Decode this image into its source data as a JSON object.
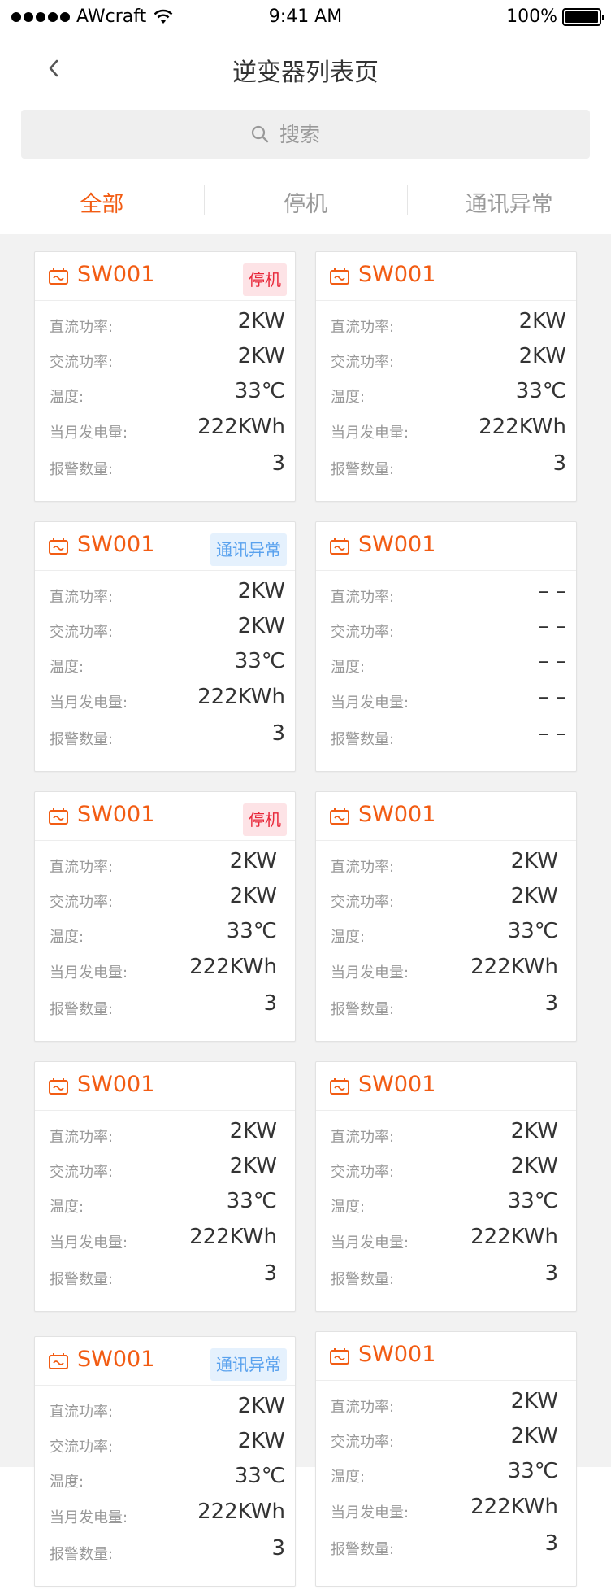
{
  "status_bar": {
    "carrier": "AWcraft",
    "time": "9:41 AM",
    "battery": "100%"
  },
  "nav": {
    "title": "逆变器列表页"
  },
  "search": {
    "placeholder": "搜索"
  },
  "tabs": [
    {
      "label": "全部",
      "active": true
    },
    {
      "label": "停机",
      "active": false
    },
    {
      "label": "通讯异常",
      "active": false
    }
  ],
  "colors": {
    "accent": "#f25c13",
    "stop_badge_bg": "#fde3e6",
    "stop_badge_text": "#e8283a",
    "comm_badge_bg": "#e5f1fd",
    "comm_badge_text": "#5aa2ee"
  },
  "field_labels": {
    "dc_power": "直流功率:",
    "ac_power": "交流功率:",
    "temperature": "温度:",
    "monthly_gen": "当月发电量:",
    "alarm_count": "报警数量:"
  },
  "cards": [
    {
      "name": "SW001",
      "badge": "停机",
      "badge_type": "stop",
      "dc": "2KW",
      "ac": "2KW",
      "temp": "33℃",
      "gen": "222KWh",
      "alarms": "3"
    },
    {
      "name": "SW001",
      "badge": "",
      "badge_type": "",
      "dc": "2KW",
      "ac": "2KW",
      "temp": "33℃",
      "gen": "222KWh",
      "alarms": "3"
    },
    {
      "name": "SW001",
      "badge": "通讯异常",
      "badge_type": "comm",
      "dc": "2KW",
      "ac": "2KW",
      "temp": "33℃",
      "gen": "222KWh",
      "alarms": "3"
    },
    {
      "name": "SW001",
      "badge": "",
      "badge_type": "",
      "dc": "– –",
      "ac": "– –",
      "temp": "– –",
      "gen": "– –",
      "alarms": "– –"
    },
    {
      "name": "SW001",
      "badge": "停机",
      "badge_type": "stop",
      "dc": "2KW",
      "ac": "2KW",
      "temp": "33℃",
      "gen": "222KWh",
      "alarms": "3"
    },
    {
      "name": "SW001",
      "badge": "",
      "badge_type": "",
      "dc": "2KW",
      "ac": "2KW",
      "temp": "33℃",
      "gen": "222KWh",
      "alarms": "3"
    },
    {
      "name": "SW001",
      "badge": "",
      "badge_type": "",
      "dc": "2KW",
      "ac": "2KW",
      "temp": "33℃",
      "gen": "222KWh",
      "alarms": "3"
    },
    {
      "name": "SW001",
      "badge": "",
      "badge_type": "",
      "dc": "2KW",
      "ac": "2KW",
      "temp": "33℃",
      "gen": "222KWh",
      "alarms": "3"
    },
    {
      "name": "SW001",
      "badge": "通讯异常",
      "badge_type": "comm",
      "dc": "2KW",
      "ac": "2KW",
      "temp": "33℃",
      "gen": "222KWh",
      "alarms": "3"
    },
    {
      "name": "SW001",
      "badge": "",
      "badge_type": "",
      "dc": "2KW",
      "ac": "2KW",
      "temp": "33℃",
      "gen": "222KWh",
      "alarms": "3"
    }
  ]
}
